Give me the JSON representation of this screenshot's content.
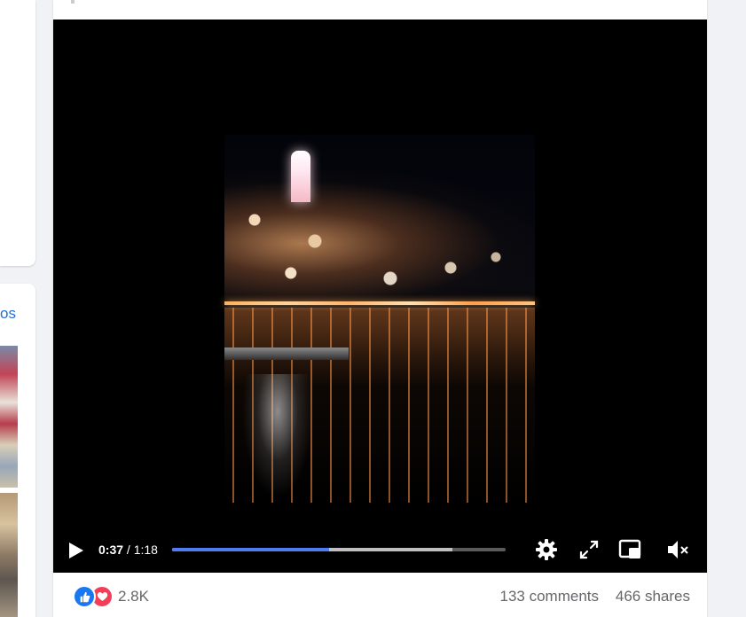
{
  "sidebar": {
    "photos_link_label": "os"
  },
  "video": {
    "current_time": "0:37",
    "duration": "1:18",
    "progress_fraction": 0.47,
    "buffered_fraction": 0.84,
    "controls": {
      "play_icon": "play-icon",
      "settings_icon": "gear-icon",
      "fullscreen_icon": "expand-icon",
      "pip_icon": "picture-in-picture-icon",
      "mute_icon": "speaker-muted-icon"
    }
  },
  "footer": {
    "reaction_icons": [
      "like-icon",
      "love-icon"
    ],
    "reaction_count": "2.8K",
    "comments_label": "133 comments",
    "shares_label": "466 shares"
  },
  "colors": {
    "accent": "#4f7cf0",
    "like": "#1877f2",
    "love": "#f33e58",
    "link": "#216fdb"
  }
}
